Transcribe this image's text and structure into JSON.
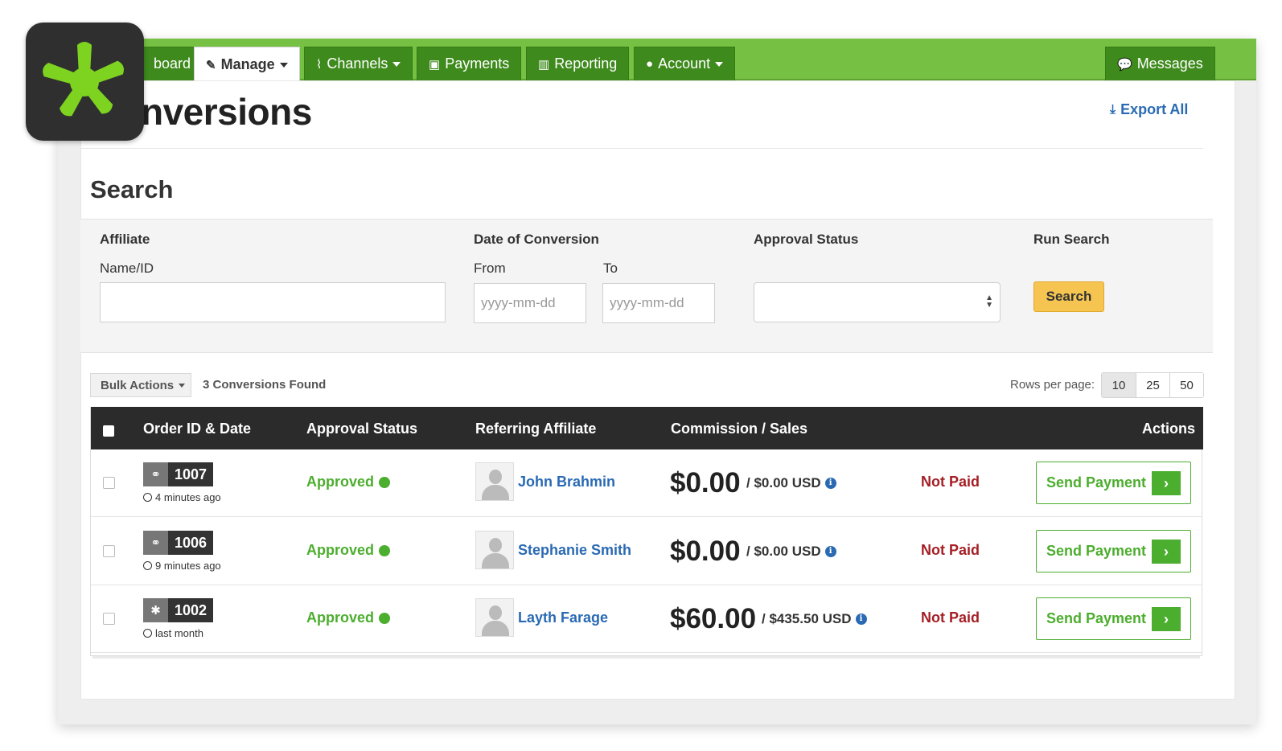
{
  "nav": {
    "tabs": [
      {
        "label": "board",
        "icon": "dashboard-icon"
      },
      {
        "label": "Manage",
        "icon": "edit-icon"
      },
      {
        "label": "Channels",
        "icon": "rss-icon"
      },
      {
        "label": "Payments",
        "icon": "money-icon"
      },
      {
        "label": "Reporting",
        "icon": "bar-chart-icon"
      },
      {
        "label": "Account",
        "icon": "user-icon"
      }
    ],
    "messages_label": "Messages",
    "accent_color": "#76c043"
  },
  "page": {
    "title": "nversions",
    "export_label": "Export All"
  },
  "search": {
    "heading": "Search",
    "affiliate_label": "Affiliate",
    "name_id_label": "Name/ID",
    "name_id_value": "",
    "date_label": "Date of Conversion",
    "from_label": "From",
    "to_label": "To",
    "from_placeholder": "yyyy-mm-dd",
    "to_placeholder": "yyyy-mm-dd",
    "approval_label": "Approval Status",
    "approval_value": "",
    "run_label": "Run Search",
    "button_label": "Search"
  },
  "toolbar": {
    "bulk_actions": "Bulk Actions",
    "found": "3 Conversions Found",
    "rows_label": "Rows per page:",
    "rows_options": [
      "10",
      "25",
      "50"
    ]
  },
  "table": {
    "headers": {
      "order": "Order ID & Date",
      "approval": "Approval Status",
      "affiliate": "Referring Affiliate",
      "commission": "Commission / Sales",
      "actions": "Actions"
    },
    "rows": [
      {
        "order_id": "1007",
        "icon": "link-icon",
        "time": "4 minutes ago",
        "status": "Approved",
        "affiliate": "John Brahmin",
        "commission": "$0.00",
        "sales": "/ $0.00 USD",
        "pay_status": "Not Paid",
        "action": "Send Payment"
      },
      {
        "order_id": "1006",
        "icon": "link-icon",
        "time": "9 minutes ago",
        "status": "Approved",
        "affiliate": "Stephanie Smith",
        "commission": "$0.00",
        "sales": "/ $0.00 USD",
        "pay_status": "Not Paid",
        "action": "Send Payment"
      },
      {
        "order_id": "1002",
        "icon": "asterisk-icon",
        "time": "last month",
        "status": "Approved",
        "affiliate": "Layth Farage",
        "commission": "$60.00",
        "sales": "/ $435.50 USD",
        "pay_status": "Not Paid",
        "action": "Send Payment"
      }
    ]
  }
}
